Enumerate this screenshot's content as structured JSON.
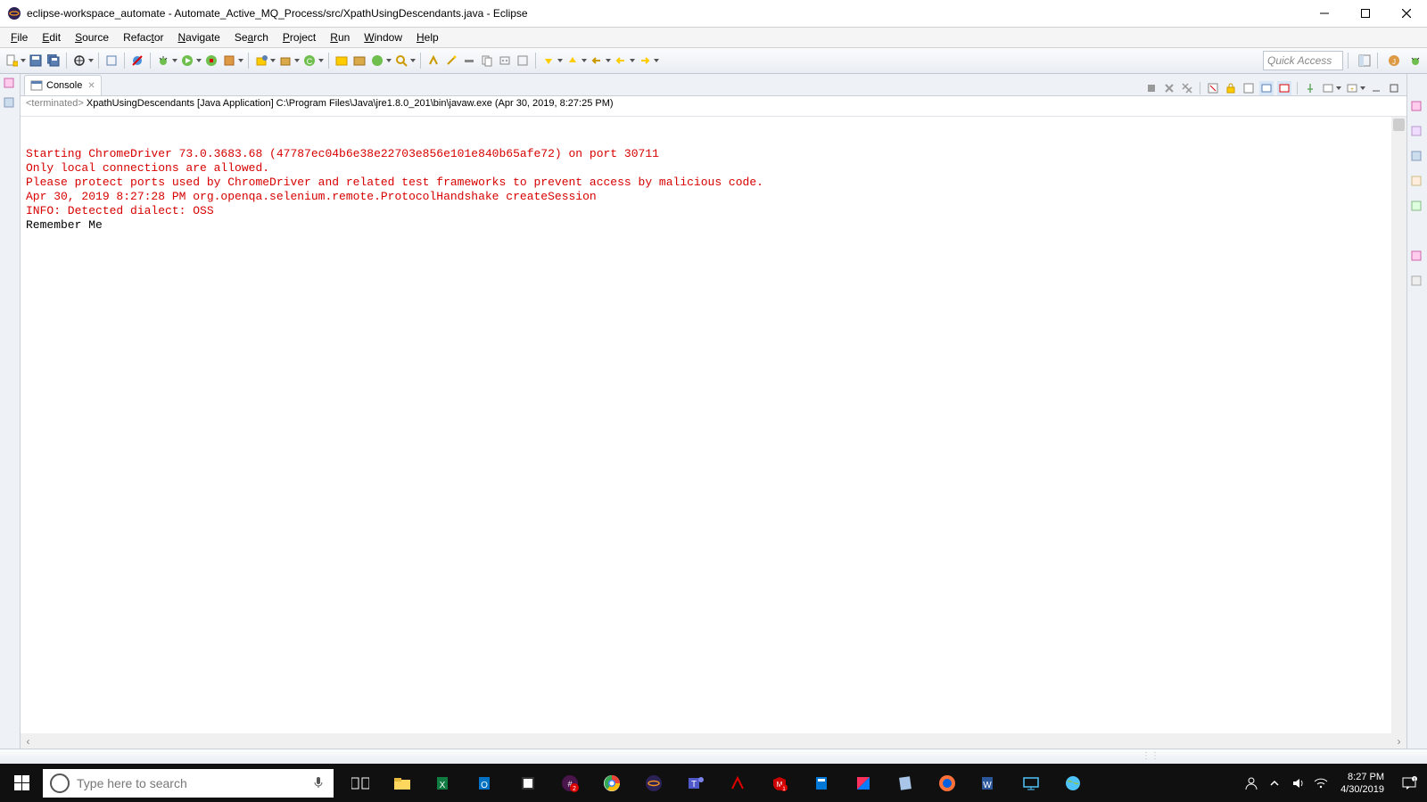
{
  "titlebar": {
    "title": "eclipse-workspace_automate - Automate_Active_MQ_Process/src/XpathUsingDescendants.java - Eclipse"
  },
  "menu": {
    "file": "File",
    "edit": "Edit",
    "source": "Source",
    "refactor": "Refactor",
    "navigate": "Navigate",
    "search": "Search",
    "project": "Project",
    "run": "Run",
    "window": "Window",
    "help": "Help"
  },
  "quick_access": {
    "placeholder": "Quick Access"
  },
  "console": {
    "tab_label": "Console",
    "proc_prefix": "<terminated>",
    "proc_main": " XpathUsingDescendants [Java Application] C:\\Program Files\\Java\\jre1.8.0_201\\bin\\javaw.exe (Apr 30, 2019, 8:27:25 PM)",
    "lines": [
      {
        "cls": "stderr",
        "text": "Starting ChromeDriver 73.0.3683.68 (47787ec04b6e38e22703e856e101e840b65afe72) on port 30711"
      },
      {
        "cls": "stderr",
        "text": "Only local connections are allowed."
      },
      {
        "cls": "stderr",
        "text": "Please protect ports used by ChromeDriver and related test frameworks to prevent access by malicious code."
      },
      {
        "cls": "stderr",
        "text": "Apr 30, 2019 8:27:28 PM org.openqa.selenium.remote.ProtocolHandshake createSession"
      },
      {
        "cls": "stderr",
        "text": "INFO: Detected dialect: OSS"
      },
      {
        "cls": "stdout",
        "text": "Remember Me"
      }
    ]
  },
  "search": {
    "placeholder": "Type here to search"
  },
  "clock": {
    "time": "8:27 PM",
    "date": "4/30/2019"
  }
}
